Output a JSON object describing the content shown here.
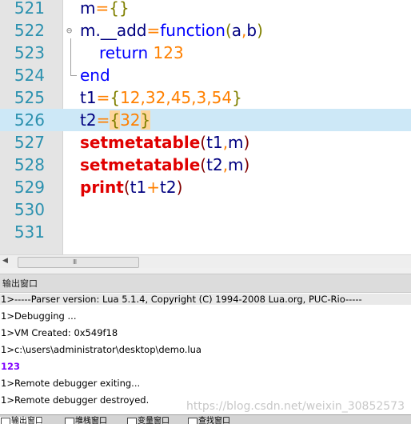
{
  "editor": {
    "current_line": 526,
    "lines": [
      {
        "num": "521",
        "tokens": [
          [
            "id",
            "m"
          ],
          [
            "op",
            "="
          ],
          [
            "br",
            "{}"
          ]
        ]
      },
      {
        "num": "522",
        "fold": "-",
        "tokens": [
          [
            "id",
            "m"
          ],
          [
            "id",
            "."
          ],
          [
            "id",
            "__add"
          ],
          [
            "op",
            "="
          ],
          [
            "kw",
            "function"
          ],
          [
            "br",
            "("
          ],
          [
            "id",
            "a"
          ],
          [
            "op",
            ","
          ],
          [
            "id",
            "b"
          ],
          [
            "br",
            ")"
          ]
        ]
      },
      {
        "num": "523",
        "indent": true,
        "tokens": [
          [
            "kw",
            "return"
          ],
          [
            "id",
            " "
          ],
          [
            "num",
            "123"
          ]
        ]
      },
      {
        "num": "524",
        "tokens": [
          [
            "kw",
            "end"
          ]
        ]
      },
      {
        "num": "525",
        "tokens": [
          [
            "id",
            "t1"
          ],
          [
            "op",
            "="
          ],
          [
            "br",
            "{"
          ],
          [
            "num",
            "12"
          ],
          [
            "op",
            ","
          ],
          [
            "num",
            "32"
          ],
          [
            "op",
            ","
          ],
          [
            "num",
            "45"
          ],
          [
            "op",
            ","
          ],
          [
            "num",
            "3"
          ],
          [
            "op",
            ","
          ],
          [
            "num",
            "54"
          ],
          [
            "br",
            "}"
          ]
        ]
      },
      {
        "num": "526",
        "tokens": [
          [
            "id",
            "t2"
          ],
          [
            "op",
            "="
          ],
          [
            "hl",
            "{"
          ],
          [
            "num",
            "32"
          ],
          [
            "hl",
            "}"
          ]
        ]
      },
      {
        "num": "527",
        "tokens": [
          [
            "fn",
            "setmetatable"
          ],
          [
            "pn",
            "("
          ],
          [
            "id",
            "t1"
          ],
          [
            "op",
            ","
          ],
          [
            "id",
            "m"
          ],
          [
            "pn",
            ")"
          ]
        ]
      },
      {
        "num": "528",
        "tokens": [
          [
            "fn",
            "setmetatable"
          ],
          [
            "pn",
            "("
          ],
          [
            "id",
            "t2"
          ],
          [
            "op",
            ","
          ],
          [
            "id",
            "m"
          ],
          [
            "pn",
            ")"
          ]
        ]
      },
      {
        "num": "529",
        "tokens": [
          [
            "fn",
            "print"
          ],
          [
            "pn",
            "("
          ],
          [
            "id",
            "t1"
          ],
          [
            "op",
            "+"
          ],
          [
            "id",
            "t2"
          ],
          [
            "pn",
            ")"
          ]
        ]
      },
      {
        "num": "530",
        "tokens": []
      },
      {
        "num": "531",
        "tokens": []
      }
    ],
    "scroll_grip": "III"
  },
  "output": {
    "title": "输出窗口",
    "lines": [
      {
        "text": "1>-----Parser version: Lua 5.1.4, Copyright (C) 1994-2008 Lua.org, PUC-Rio-----",
        "style": "first"
      },
      {
        "text": "1>Debugging ...",
        "style": ""
      },
      {
        "text": "1>VM Created: 0x549f18",
        "style": ""
      },
      {
        "text": "1>c:\\users\\administrator\\desktop\\demo.lua",
        "style": ""
      },
      {
        "text": "123",
        "style": "purple"
      },
      {
        "text": "1>Remote debugger exiting...",
        "style": ""
      },
      {
        "text": "1>Remote debugger destroyed.",
        "style": ""
      }
    ],
    "watermark": "https://blog.csdn.net/weixin_30852573"
  },
  "tabs": [
    {
      "label": "输出窗口",
      "active": true
    },
    {
      "label": "堆栈窗口",
      "active": false
    },
    {
      "label": "变量窗口",
      "active": false
    },
    {
      "label": "查找窗口",
      "active": false
    }
  ],
  "colors": {
    "current_line": "#cde8f7",
    "line_number": "#2b91af",
    "keyword": "#0000ff",
    "number": "#ff8000",
    "builtin": "#e00000"
  }
}
